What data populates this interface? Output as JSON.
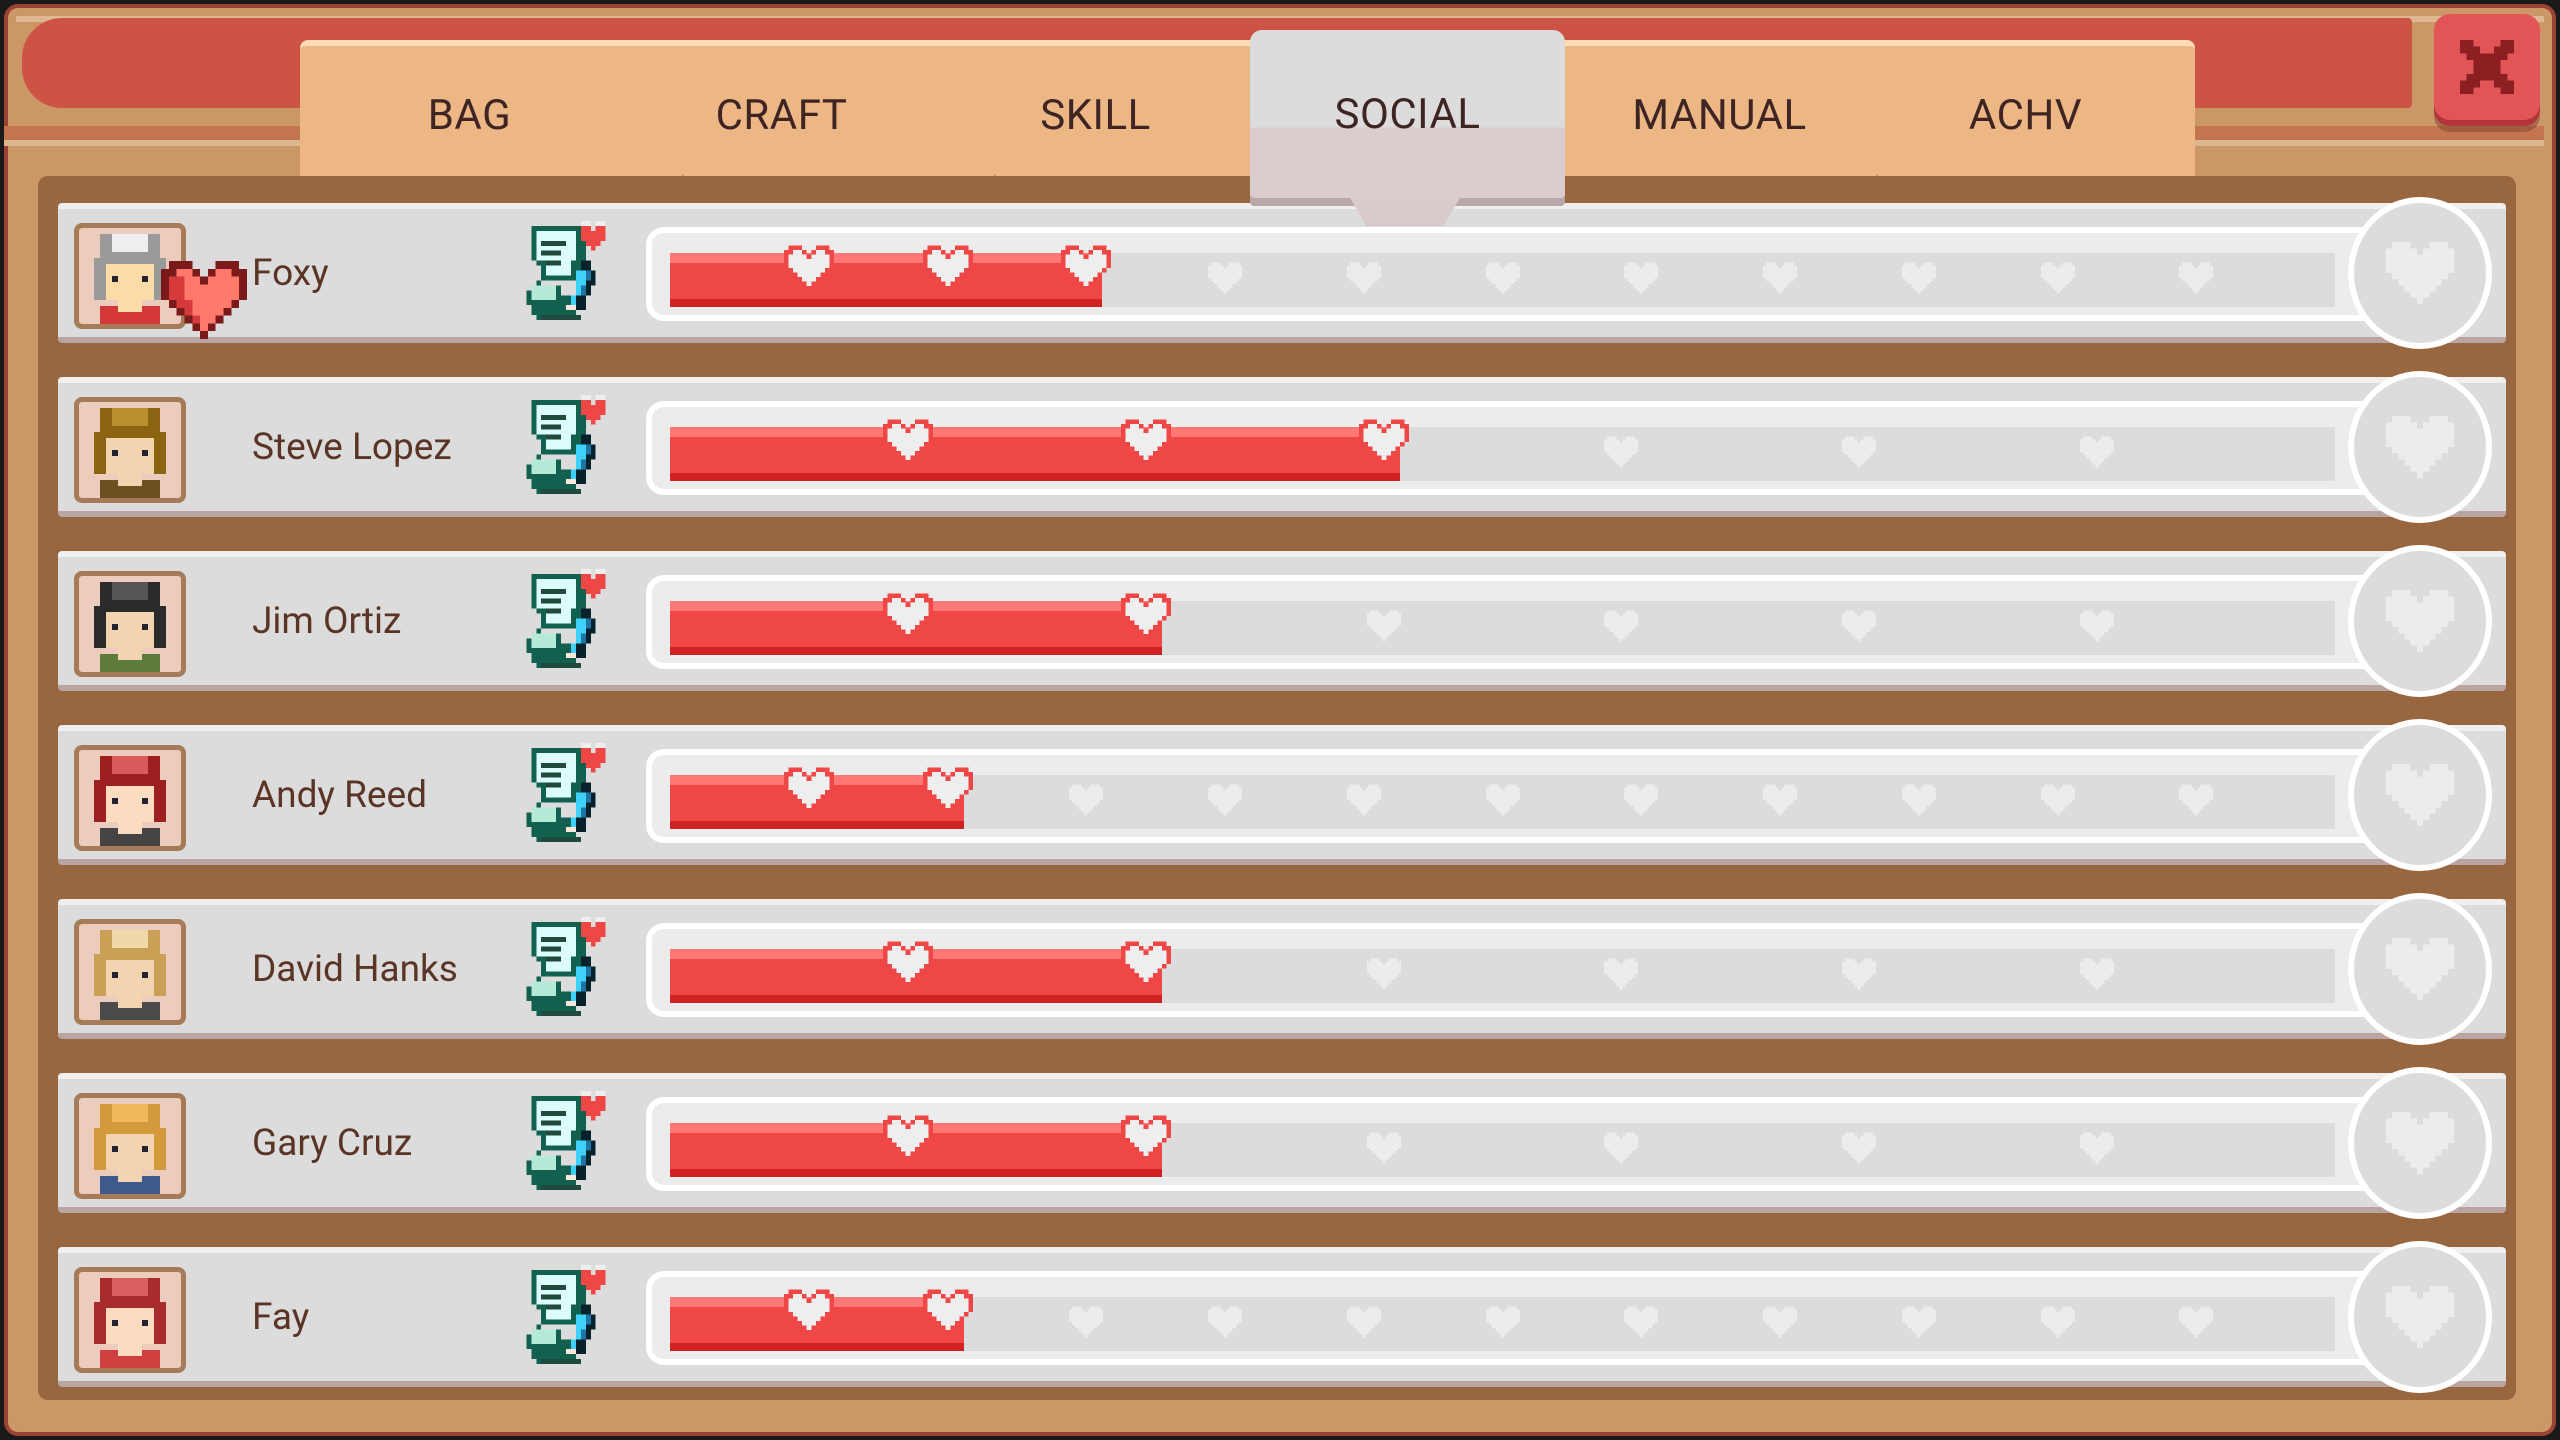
{
  "window": {
    "close_icon": "close-x-icon"
  },
  "tabs": [
    {
      "label": "BAG",
      "active": false
    },
    {
      "label": "CRAFT",
      "active": false
    },
    {
      "label": "SKILL",
      "active": false
    },
    {
      "label": "SOCIAL",
      "active": true
    },
    {
      "label": "MANUAL",
      "active": false
    },
    {
      "label": "ACHV",
      "active": false
    }
  ],
  "colors": {
    "accent_red": "#ef4646",
    "header_red": "#cd5444",
    "tab_bg": "#ecb785",
    "panel_brown": "#98663f",
    "row_bg": "#dcdcdc",
    "text_dark": "#5a3526"
  },
  "social": {
    "rows": [
      {
        "name": "Foxy",
        "avatar": "foxy-portrait",
        "favorite": true,
        "hearts_filled": 3,
        "hearts_total": 11,
        "action_icon": "write-letter-icon"
      },
      {
        "name": "Steve Lopez",
        "avatar": "steve-lopez-portrait",
        "favorite": false,
        "hearts_filled": 3,
        "hearts_total": 6,
        "action_icon": "write-letter-icon"
      },
      {
        "name": "Jim Ortiz",
        "avatar": "jim-ortiz-portrait",
        "favorite": false,
        "hearts_filled": 2,
        "hearts_total": 6,
        "action_icon": "write-letter-icon"
      },
      {
        "name": "Andy Reed",
        "avatar": "andy-reed-portrait",
        "favorite": false,
        "hearts_filled": 2,
        "hearts_total": 11,
        "action_icon": "write-letter-icon"
      },
      {
        "name": "David Hanks",
        "avatar": "david-hanks-portrait",
        "favorite": false,
        "hearts_filled": 2,
        "hearts_total": 6,
        "action_icon": "write-letter-icon"
      },
      {
        "name": "Gary Cruz",
        "avatar": "gary-cruz-portrait",
        "favorite": false,
        "hearts_filled": 2,
        "hearts_total": 6,
        "action_icon": "write-letter-icon"
      },
      {
        "name": "Fay",
        "avatar": "fay-portrait",
        "favorite": false,
        "hearts_filled": 2,
        "hearts_total": 11,
        "action_icon": "write-letter-icon"
      }
    ]
  }
}
